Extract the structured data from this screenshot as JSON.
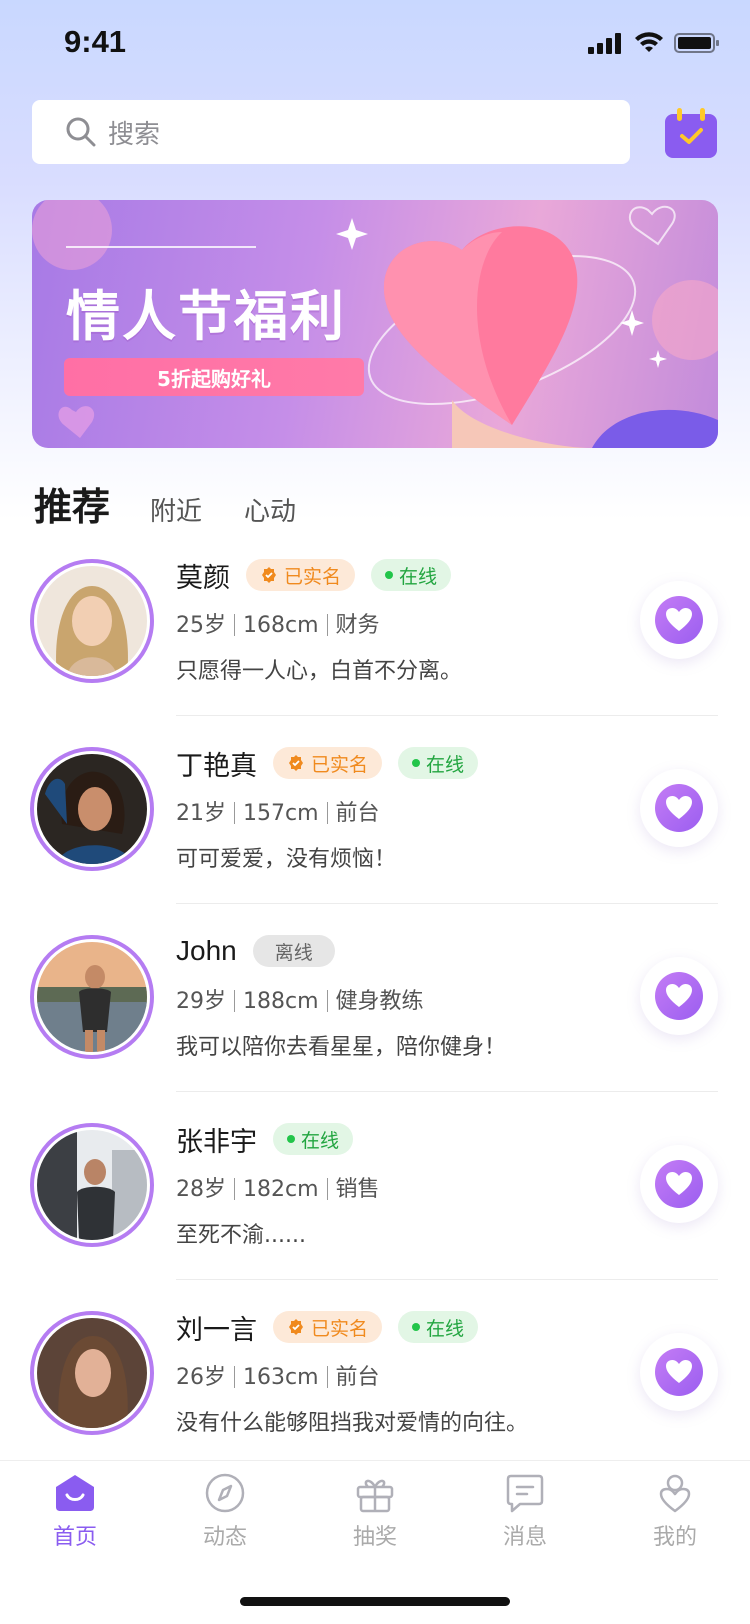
{
  "status_bar": {
    "time": "9:41"
  },
  "search": {
    "placeholder": "搜索"
  },
  "banner": {
    "title": "情人节福利",
    "subtitle": "5折起购好礼"
  },
  "tabs": [
    {
      "label": "推荐",
      "active": true
    },
    {
      "label": "附近",
      "active": false
    },
    {
      "label": "心动",
      "active": false
    }
  ],
  "users": [
    {
      "name": "莫颜",
      "verified": "已实名",
      "status": "在线",
      "age": "25岁",
      "height": "168cm",
      "job": "财务",
      "motto": "只愿得一人心，白首不分离。"
    },
    {
      "name": "丁艳真",
      "verified": "已实名",
      "status": "在线",
      "age": "21岁",
      "height": "157cm",
      "job": "前台",
      "motto": "可可爱爱，没有烦恼！"
    },
    {
      "name": "John",
      "verified": "",
      "status": "离线",
      "age": "29岁",
      "height": "188cm",
      "job": "健身教练",
      "motto": "我可以陪你去看星星，陪你健身！"
    },
    {
      "name": "张非宇",
      "verified": "",
      "status": "在线",
      "age": "28岁",
      "height": "182cm",
      "job": "销售",
      "motto": "至死不渝......"
    },
    {
      "name": "刘一言",
      "verified": "已实名",
      "status": "在线",
      "age": "26岁",
      "height": "163cm",
      "job": "前台",
      "motto": "没有什么能够阻挡我对爱情的向往。"
    }
  ],
  "tabbar": [
    {
      "label": "首页",
      "icon": "home-icon",
      "active": true
    },
    {
      "label": "动态",
      "icon": "compass-icon",
      "active": false
    },
    {
      "label": "抽奖",
      "icon": "gift-icon",
      "active": false
    },
    {
      "label": "消息",
      "icon": "message-icon",
      "active": false
    },
    {
      "label": "我的",
      "icon": "profile-icon",
      "active": false
    }
  ],
  "colors": {
    "accent": "#8a5cf0",
    "avatar_ring": "#b57cf2",
    "verified": "#f08a1e",
    "online": "#22a540"
  }
}
